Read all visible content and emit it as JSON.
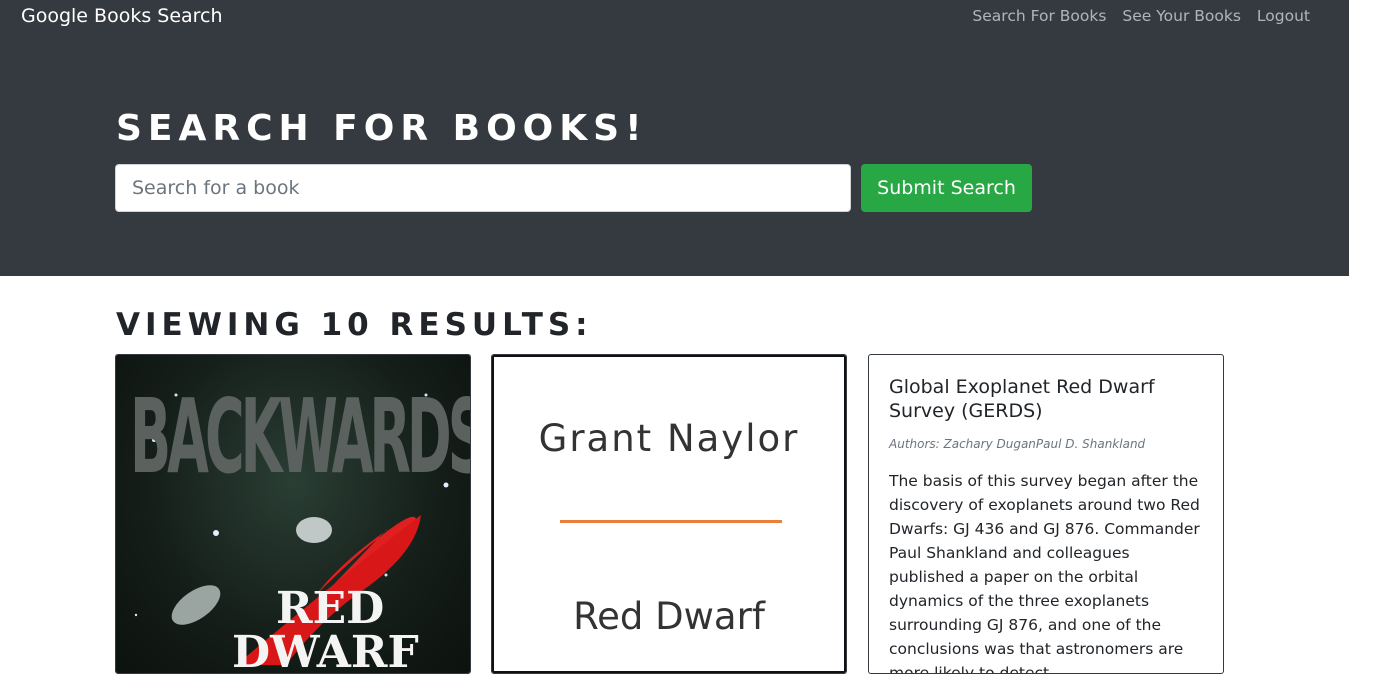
{
  "nav": {
    "brand": "Google Books Search",
    "links": [
      "Search For Books",
      "See Your Books",
      "Logout"
    ]
  },
  "hero": {
    "title": "Search for Books!",
    "search_placeholder": "Search for a book",
    "search_value": "",
    "submit_label": "Submit Search"
  },
  "results": {
    "heading": "Viewing 10 results:",
    "cards": [
      {
        "cover_text": [
          "BACKWARDS",
          "RED",
          "DWARF"
        ]
      },
      {
        "cover_author": "Grant Naylor",
        "cover_title": "Red Dwarf"
      },
      {
        "title": "Global Exoplanet Red Dwarf Survey (GERDS)",
        "authors": "Authors: Zachary DuganPaul D. Shankland",
        "description": "The basis of this survey began after the discovery of exoplanets around two Red Dwarfs: GJ 436 and GJ 876. Commander Paul Shankland and colleagues published a paper on the orbital dynamics of the three exoplanets surrounding GJ 876, and one of the conclusions was that astronomers are more likely to detect"
      }
    ]
  },
  "colors": {
    "navbar": "#343a40",
    "success": "#28a745",
    "accent_orange": "#e8803a",
    "cover_red": "#e02020"
  }
}
